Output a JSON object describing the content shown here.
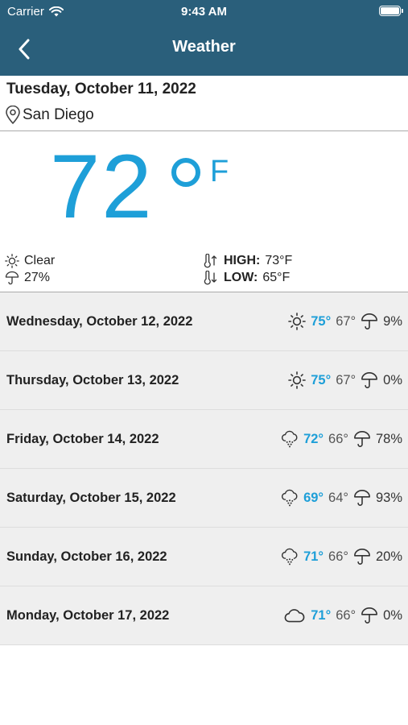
{
  "status_bar": {
    "carrier": "Carrier",
    "time": "9:43 AM"
  },
  "nav": {
    "title": "Weather"
  },
  "current": {
    "date": "Tuesday, October 11, 2022",
    "location": "San Diego",
    "temp": "72",
    "unit": "F",
    "condition": "Clear",
    "precip": "27%",
    "high_label": "HIGH:",
    "high": "73°F",
    "low_label": "LOW:",
    "low": "65°F"
  },
  "forecast": [
    {
      "day": "Wednesday, October 12, 2022",
      "icon": "sun-icon",
      "high": "75°",
      "low": "67°",
      "precip": "9%"
    },
    {
      "day": "Thursday, October 13, 2022",
      "icon": "sun-icon",
      "high": "75°",
      "low": "67°",
      "precip": "0%"
    },
    {
      "day": "Friday, October 14, 2022",
      "icon": "rain-cloud-icon",
      "high": "72°",
      "low": "66°",
      "precip": "78%"
    },
    {
      "day": "Saturday, October 15, 2022",
      "icon": "rain-cloud-icon",
      "high": "69°",
      "low": "64°",
      "precip": "93%"
    },
    {
      "day": "Sunday, October 16, 2022",
      "icon": "rain-cloud-icon",
      "high": "71°",
      "low": "66°",
      "precip": "20%"
    },
    {
      "day": "Monday, October 17, 2022",
      "icon": "cloud-icon",
      "high": "71°",
      "low": "66°",
      "precip": "0%"
    }
  ],
  "colors": {
    "header": "#2a5f7b",
    "accent": "#1e9fd8",
    "row": "#efefef"
  }
}
